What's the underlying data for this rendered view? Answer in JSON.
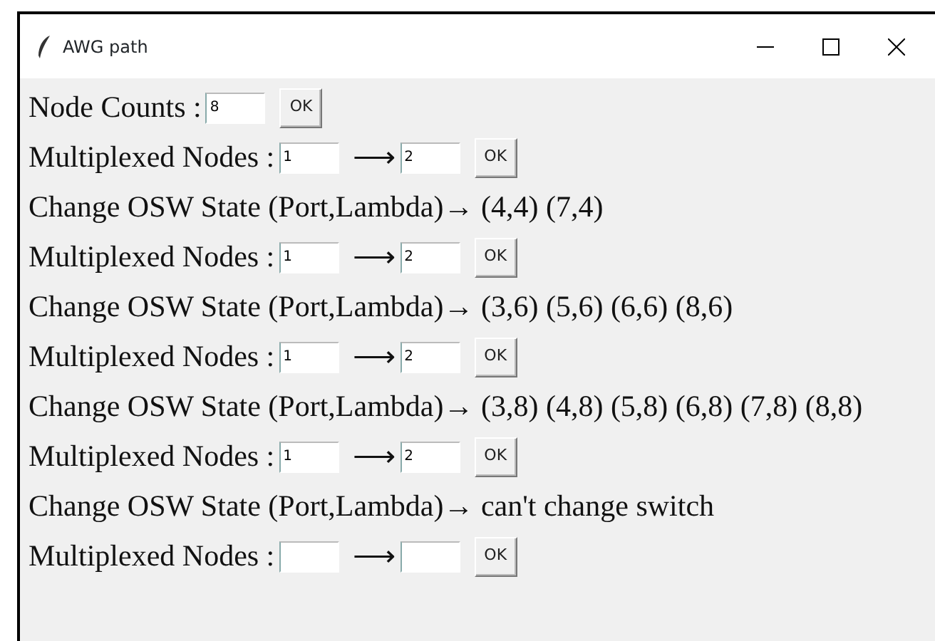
{
  "window": {
    "title": "AWG path"
  },
  "rows": [
    {
      "kind": "count",
      "label": "Node Counts :",
      "value": "8",
      "button": "OK"
    },
    {
      "kind": "multiplex",
      "label": "Multiplexed Nodes :",
      "from": "1",
      "arrow": "⟶",
      "to": "2",
      "button": "OK"
    },
    {
      "kind": "state",
      "text": "Change OSW State (Port,Lambda)→ (4,4) (7,4)"
    },
    {
      "kind": "multiplex",
      "label": "Multiplexed Nodes :",
      "from": "1",
      "arrow": "⟶",
      "to": "2",
      "button": "OK"
    },
    {
      "kind": "state",
      "text": "Change OSW State (Port,Lambda)→ (3,6) (5,6) (6,6) (8,6)"
    },
    {
      "kind": "multiplex",
      "label": "Multiplexed Nodes :",
      "from": "1",
      "arrow": "⟶",
      "to": "2",
      "button": "OK"
    },
    {
      "kind": "state",
      "text": "Change OSW State (Port,Lambda)→ (3,8) (4,8) (5,8) (6,8) (7,8) (8,8)"
    },
    {
      "kind": "multiplex",
      "label": "Multiplexed Nodes :",
      "from": "1",
      "arrow": "⟶",
      "to": "2",
      "button": "OK"
    },
    {
      "kind": "state",
      "text": "Change OSW State (Port,Lambda)→ can't change switch"
    },
    {
      "kind": "multiplex",
      "label": "Multiplexed Nodes :",
      "arrow": "⟶",
      "button": "OK"
    }
  ]
}
